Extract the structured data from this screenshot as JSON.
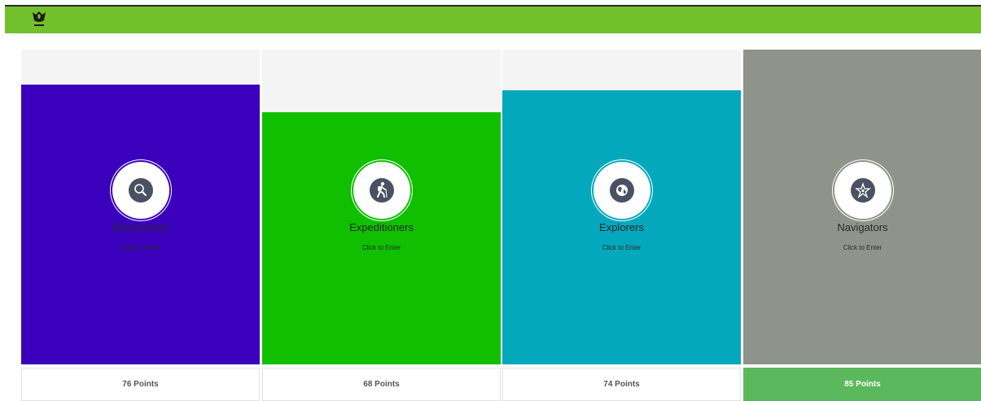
{
  "header": {
    "logo_icon": "explorer-emblem-icon",
    "color": "#72c02c"
  },
  "teams": [
    {
      "name": "Discoverers",
      "action": "Click to Enter",
      "points": "76 Points",
      "icon": "magnifier-icon",
      "color": "#3a00bb",
      "fill_level": 0.89,
      "highlighted": false
    },
    {
      "name": "Expeditioners",
      "action": "Click to Enter",
      "points": "68 Points",
      "icon": "hiker-icon",
      "color": "#0fbf00",
      "fill_level": 0.8,
      "highlighted": false
    },
    {
      "name": "Explorers",
      "action": "Click to Enter",
      "points": "74 Points",
      "icon": "globe-icon",
      "color": "#04a8bc",
      "fill_level": 0.87,
      "highlighted": false
    },
    {
      "name": "Navigators",
      "action": "Click to Enter",
      "points": "85 Points",
      "icon": "compass-star-icon",
      "color": "#8f948a",
      "fill_level": 1.0,
      "highlighted": true,
      "highlight_color": "#5cb85c"
    }
  ]
}
